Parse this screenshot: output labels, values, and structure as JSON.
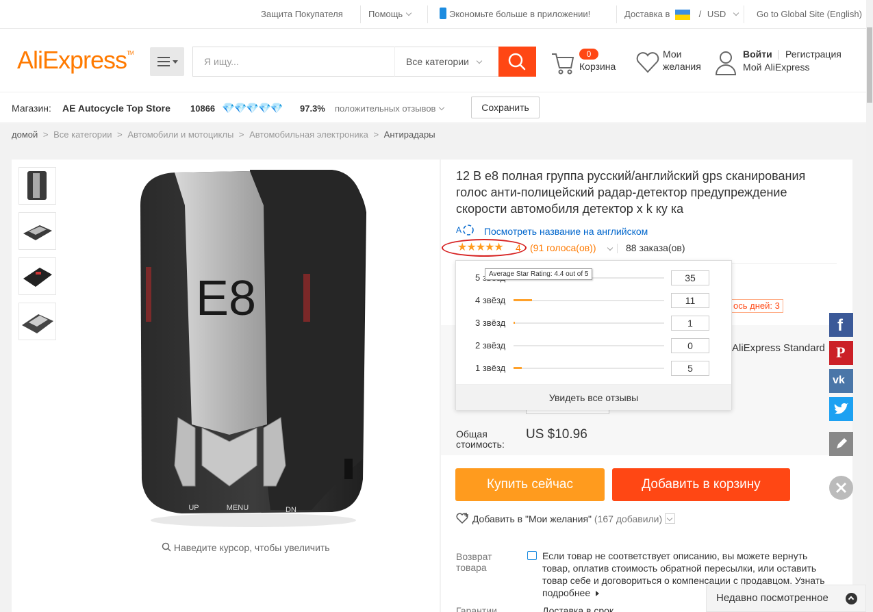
{
  "topbar": {
    "buyer_protection": "Защита Покупателя",
    "help": "Помощь",
    "app_promo": "Экономьте больше в приложении!",
    "ship_to": "Доставка в",
    "currency_sep": "/",
    "currency": "USD",
    "global_site": "Go to Global Site (English)"
  },
  "header": {
    "logo": "AliExpress",
    "logo_tm": "TM",
    "search_placeholder": "Я ищу...",
    "category_select": "Все категории",
    "cart_count": "0",
    "cart_label": "Корзина",
    "wishlist_label_1": "Мои",
    "wishlist_label_2": "желания",
    "login": "Войти",
    "register": "Регистрация",
    "my_aliexpress": "Мой AliExpress"
  },
  "store": {
    "label": "Магазин:",
    "name": "AE Autocycle Top Store",
    "score": "10866",
    "positive_pct": "97.3%",
    "positive_label": "положительных отзывов",
    "save_button": "Сохранить"
  },
  "breadcrumb": {
    "items": [
      "домой",
      "Все категории",
      "Автомобили и мотоциклы",
      "Автомобильная электроника",
      "Антирадары"
    ],
    "sep": ">"
  },
  "gallery": {
    "zoom_hint": "Наведите курсор, чтобы увеличить",
    "device_text": "E8",
    "btn_up": "UP",
    "btn_menu": "MENU",
    "btn_dn": "DN"
  },
  "product": {
    "title": "12 В e8 полная группа русский/английский gps сканирования голос анти-полицейский радар-детектор предупреждение скорости автомобиля детектор x k ку ка",
    "translate_link": "Посмотреть название на английском",
    "rating_partial": "4",
    "votes": "(91 голоса(ов))",
    "orders": "88 заказа(ов)",
    "promo_partial": "ось дней: 3",
    "shipping_partial": "AliExpress Standard",
    "total_label": "Общая стоимость:",
    "total_price": "US $10.96",
    "buy_now": "Купить сейчас",
    "add_to_cart": "Добавить в корзину",
    "wishlist_add": "Добавить в \"Мои желания\"",
    "wishlist_count": "(167 добавили)",
    "return_label": "Возврат товара",
    "return_text": "Если товар не соответствует описанию, вы можете вернуть товар, оплатив стоимость обратной пересылки, или оставить товар себе и договориться о компенсации с продавцом.",
    "return_more": "Узнать подробнее",
    "guarantee_label": "Гарантии",
    "guarantee_text": "Доставка в срок"
  },
  "rating_popup": {
    "tooltip": "Average Star Rating: 4.4 out of 5",
    "rows": [
      {
        "label": "5 звёзд",
        "count": "35",
        "fraction": 0.385
      },
      {
        "label": "4 звёзд",
        "count": "11",
        "fraction": 0.121
      },
      {
        "label": "3 звёзд",
        "count": "1",
        "fraction": 0.011
      },
      {
        "label": "2 звёзд",
        "count": "0",
        "fraction": 0.0
      },
      {
        "label": "1 звёзд",
        "count": "5",
        "fraction": 0.055
      }
    ],
    "see_all": "Увидеть все отзывы"
  },
  "rating_value": 4.4,
  "recently_viewed": "Недавно посмотренное",
  "colors": {
    "brand_orange": "#ff7a00",
    "accent_red": "#ff4714",
    "buy_orange": "#ff9b1e",
    "link_blue": "#0066cc",
    "star": "#ff9b1e",
    "facebook": "#3b5998",
    "pinterest": "#cb2027",
    "vk": "#4a76a8",
    "twitter": "#1da1f2"
  }
}
